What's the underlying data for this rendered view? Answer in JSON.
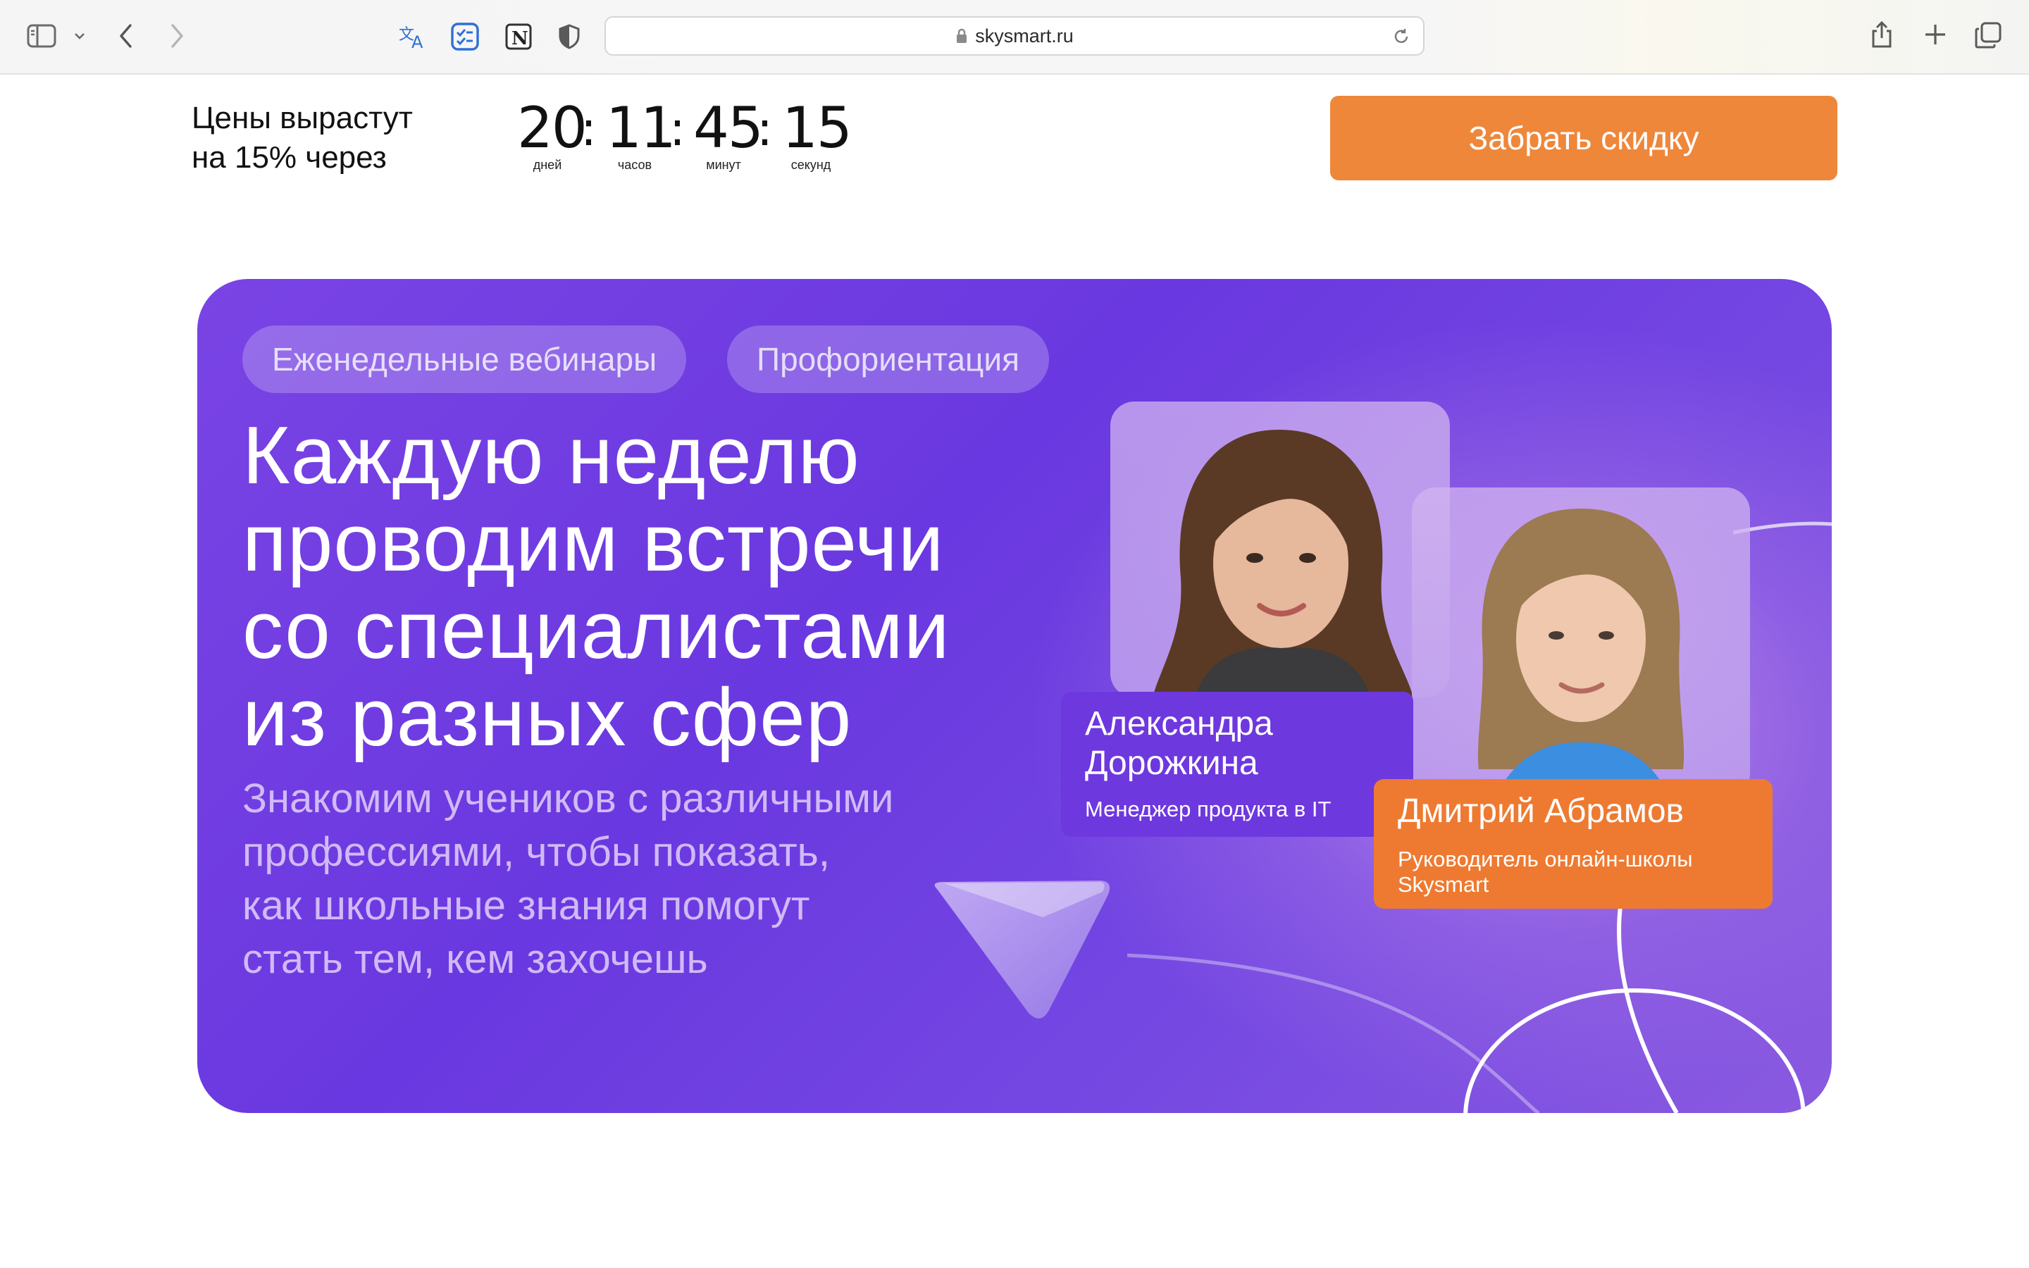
{
  "browser": {
    "url": "skysmart.ru"
  },
  "promo": {
    "text_line1": "Цены вырастут",
    "text_line2": "на 15% через",
    "timer": {
      "days": "20",
      "hours": "11",
      "minutes": "45",
      "seconds": "15",
      "separator": ":",
      "days_label": "дней",
      "hours_label": "часов",
      "minutes_label": "минут",
      "seconds_label": "секунд"
    },
    "cta_label": "Забрать скидку"
  },
  "hero": {
    "chips": [
      "Еженедельные вебинары",
      "Профориентация"
    ],
    "headline_lines": [
      "Каждую неделю",
      "проводим встречи",
      "со специалистами",
      "из разных сфер"
    ],
    "subtitle_lines": [
      "Знакомим учеников с различными",
      "профессиями, чтобы показать,",
      "как школьные знания помогут",
      "стать тем, кем захочешь"
    ],
    "speakers": [
      {
        "name_line1": "Александра",
        "name_line2": "Дорожкина",
        "role": "Менеджер продукта в IT"
      },
      {
        "name": "Дмитрий Абрамов",
        "role_line1": "Руководитель онлайн-школы",
        "role_line2": "Skysmart"
      }
    ]
  },
  "colors": {
    "accent_orange": "#ee873a",
    "banner_purple": "#6e38df",
    "card_orange": "#ee7a31"
  }
}
